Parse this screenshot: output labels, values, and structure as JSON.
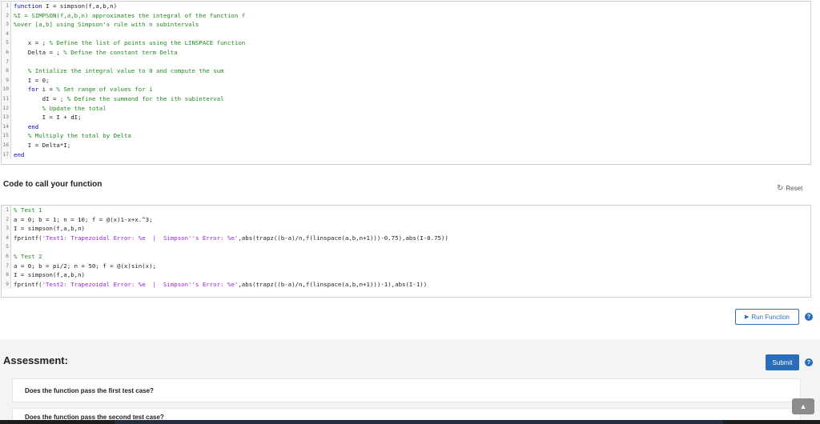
{
  "function_editor": {
    "lines": [
      {
        "n": "1",
        "segments": [
          {
            "t": "function",
            "c": "kw"
          },
          {
            "t": " I = simpson(f,a,b,n)",
            "c": ""
          }
        ]
      },
      {
        "n": "2",
        "segments": [
          {
            "t": "%I = SIMPSON(f,a,b,n) approximates the integral of the function f",
            "c": "cm"
          }
        ]
      },
      {
        "n": "3",
        "segments": [
          {
            "t": "%over [a,b] using Simpson's rule with n subintervals",
            "c": "cm"
          }
        ]
      },
      {
        "n": "4",
        "segments": []
      },
      {
        "n": "5",
        "segments": [
          {
            "t": "    x = ; ",
            "c": ""
          },
          {
            "t": "% Define the list of points using the LINSPACE function",
            "c": "cm"
          }
        ]
      },
      {
        "n": "6",
        "segments": [
          {
            "t": "    Delta = ; ",
            "c": ""
          },
          {
            "t": "% Define the constant term Delta",
            "c": "cm"
          }
        ]
      },
      {
        "n": "7",
        "segments": []
      },
      {
        "n": "8",
        "segments": [
          {
            "t": "    ",
            "c": ""
          },
          {
            "t": "% Intialize the integral value to 0 and compute the sum",
            "c": "cm"
          }
        ]
      },
      {
        "n": "9",
        "segments": [
          {
            "t": "    I = 0;",
            "c": ""
          }
        ]
      },
      {
        "n": "10",
        "segments": [
          {
            "t": "    ",
            "c": ""
          },
          {
            "t": "for",
            "c": "kw"
          },
          {
            "t": " i = ",
            "c": ""
          },
          {
            "t": "% Set range of values for i",
            "c": "cm"
          }
        ]
      },
      {
        "n": "11",
        "segments": [
          {
            "t": "        dI = ; ",
            "c": ""
          },
          {
            "t": "% Define the summand for the ith subinterval",
            "c": "cm"
          }
        ]
      },
      {
        "n": "12",
        "segments": [
          {
            "t": "        ",
            "c": ""
          },
          {
            "t": "% Update the total",
            "c": "cm"
          }
        ]
      },
      {
        "n": "13",
        "segments": [
          {
            "t": "        I = I + dI;",
            "c": ""
          }
        ]
      },
      {
        "n": "14",
        "segments": [
          {
            "t": "    ",
            "c": ""
          },
          {
            "t": "end",
            "c": "kw"
          }
        ]
      },
      {
        "n": "15",
        "segments": [
          {
            "t": "    ",
            "c": ""
          },
          {
            "t": "% Multiply the total by Delta",
            "c": "cm"
          }
        ]
      },
      {
        "n": "16",
        "segments": [
          {
            "t": "    I = Delta*I;",
            "c": ""
          }
        ]
      },
      {
        "n": "17",
        "segments": [
          {
            "t": "end",
            "c": "kw"
          }
        ]
      }
    ]
  },
  "call_section": {
    "title": "Code to call your function",
    "reset_label": "Reset",
    "reset_icon": "refresh-icon"
  },
  "call_editor": {
    "lines": [
      {
        "n": "1",
        "segments": [
          {
            "t": "% Test 1",
            "c": "cm"
          }
        ]
      },
      {
        "n": "2",
        "segments": [
          {
            "t": "a = 0; b = 1; n = 10; f = @(x)1-x+x.^3;",
            "c": ""
          }
        ]
      },
      {
        "n": "3",
        "segments": [
          {
            "t": "I = simpson(f,a,b,n)",
            "c": ""
          }
        ]
      },
      {
        "n": "4",
        "segments": [
          {
            "t": "fprintf(",
            "c": ""
          },
          {
            "t": "'Test1: Trapezoidal Error: %e  |  Simpson''s Error: %e'",
            "c": "str"
          },
          {
            "t": ",abs(trapz((b-a)/n,f(linspace(a,b,n+1)))-0.75),abs(I-0.75))",
            "c": ""
          }
        ]
      },
      {
        "n": "5",
        "segments": []
      },
      {
        "n": "6",
        "segments": [
          {
            "t": "% Test 2",
            "c": "cm"
          }
        ]
      },
      {
        "n": "7",
        "segments": [
          {
            "t": "a = 0; b = pi/2; n = 50; f = @(x)sin(x);",
            "c": ""
          }
        ]
      },
      {
        "n": "8",
        "segments": [
          {
            "t": "I = simpson(f,a,b,n)",
            "c": ""
          }
        ]
      },
      {
        "n": "9",
        "segments": [
          {
            "t": "fprintf(",
            "c": ""
          },
          {
            "t": "'Test2: Trapezoidal Error: %e  |  Simpson''s Error: %e'",
            "c": "str"
          },
          {
            "t": ",abs(trapz((b-a)/n,f(linspace(a,b,n+1)))-1),abs(I-1))",
            "c": ""
          }
        ]
      }
    ]
  },
  "run_button": {
    "label": "Run Function",
    "icon": "play-icon"
  },
  "help_glyph": "?",
  "assessment": {
    "title": "Assessment:",
    "submit_label": "Submit",
    "questions": [
      "Does the function pass the first test case?",
      "Does the function pass the second test case?"
    ]
  },
  "scroll_top_icon": "chevron-up-icon",
  "colors": {
    "accent": "#2a6ebb",
    "keyword": "#0000d0",
    "comment": "#228b22",
    "string": "#a020f0"
  }
}
